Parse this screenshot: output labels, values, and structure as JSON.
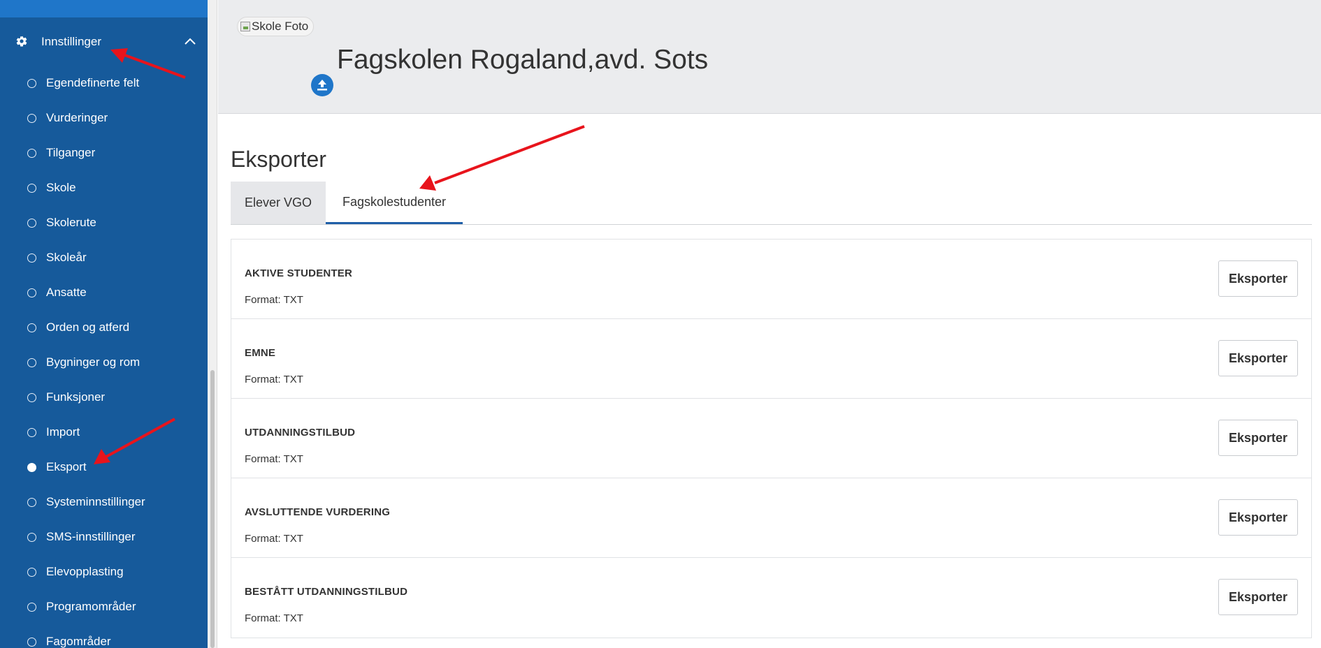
{
  "sidebar": {
    "section_label": "Innstillinger",
    "items": [
      {
        "label": "Egendefinerte felt",
        "active": false
      },
      {
        "label": "Vurderinger",
        "active": false
      },
      {
        "label": "Tilganger",
        "active": false
      },
      {
        "label": "Skole",
        "active": false
      },
      {
        "label": "Skolerute",
        "active": false
      },
      {
        "label": "Skoleår",
        "active": false
      },
      {
        "label": "Ansatte",
        "active": false
      },
      {
        "label": "Orden og atferd",
        "active": false
      },
      {
        "label": "Bygninger og rom",
        "active": false
      },
      {
        "label": "Funksjoner",
        "active": false
      },
      {
        "label": "Import",
        "active": false
      },
      {
        "label": "Eksport",
        "active": true
      },
      {
        "label": "Systeminnstillinger",
        "active": false
      },
      {
        "label": "SMS-innstillinger",
        "active": false
      },
      {
        "label": "Elevopplasting",
        "active": false
      },
      {
        "label": "Programområder",
        "active": false
      },
      {
        "label": "Fagområder",
        "active": false
      }
    ]
  },
  "header": {
    "photo_alt": "Skole Foto",
    "school_name": "Fagskolen Rogaland,avd. Sots"
  },
  "main": {
    "title": "Eksporter",
    "tabs": [
      {
        "label": "Elever VGO",
        "active": false
      },
      {
        "label": "Fagskolestudenter",
        "active": true
      }
    ],
    "exports": [
      {
        "title": "AKTIVE STUDENTER",
        "format": "Format: TXT",
        "button": "Eksporter"
      },
      {
        "title": "EMNE",
        "format": "Format: TXT",
        "button": "Eksporter"
      },
      {
        "title": "UTDANNINGSTILBUD",
        "format": "Format: TXT",
        "button": "Eksporter"
      },
      {
        "title": "AVSLUTTENDE VURDERING",
        "format": "Format: TXT",
        "button": "Eksporter"
      },
      {
        "title": "BESTÅTT UTDANNINGSTILBUD",
        "format": "Format: TXT",
        "button": "Eksporter"
      }
    ]
  },
  "colors": {
    "sidebar_bg": "#165a9b",
    "accent": "#1f76c9",
    "annotation_arrow": "#e8141c"
  }
}
